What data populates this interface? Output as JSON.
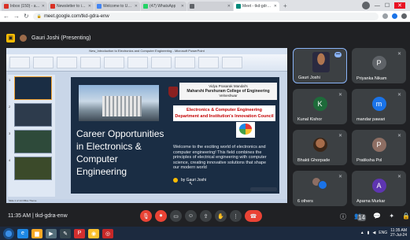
{
  "browser": {
    "tabs": [
      {
        "label": "Inbox (150) - aparna.murkar@...",
        "color": "#d93025",
        "active": false
      },
      {
        "label": "Newsletter to invite as a Resour...",
        "color": "#d93025",
        "active": false
      },
      {
        "label": "Welcome to University of Mur...",
        "color": "#4285f4",
        "active": false
      },
      {
        "label": "(47) WhatsApp",
        "color": "#25d366",
        "active": false
      },
      {
        "label": "",
        "color": "#5f6368",
        "active": false
      },
      {
        "label": "Meet - tkd-gdra-enw",
        "color": "#00897b",
        "active": true
      }
    ],
    "new_tab": "+",
    "url": "meet.google.com/tkd-gdra-enw",
    "controls": {
      "minimize": "—",
      "maximize": "☐",
      "close": "✕"
    }
  },
  "meet": {
    "presenter_label": "Gauri Joshi (Presenting)",
    "time": "11:35 AM",
    "meeting_code": "tkd-gdra-enw",
    "participants_count": "14",
    "participants": [
      {
        "name": "Gauri Joshi",
        "type": "photo",
        "speaking": true
      },
      {
        "name": "Priyanka Nikam",
        "type": "letter",
        "letter": "P",
        "color": "#5f6368"
      },
      {
        "name": "Kunal Kishor",
        "type": "letter",
        "letter": "K",
        "color": "#1e6b3a"
      },
      {
        "name": "mandar pawari",
        "type": "letter",
        "letter": "m",
        "color": "#1a73e8"
      },
      {
        "name": "Bhakti Ghorpade",
        "type": "photo"
      },
      {
        "name": "Pratiksha Pol",
        "type": "letter",
        "letter": "P",
        "color": "#8d6e63"
      },
      {
        "name": "6 others",
        "type": "others"
      },
      {
        "name": "Aparna Murkar",
        "type": "letter",
        "letter": "A",
        "color": "#5e35b1"
      }
    ]
  },
  "ppt": {
    "window_title": "New_Introduction to Electronics and Computer Engineering - Microsoft PowerPoint",
    "slide": {
      "title": "Career Opportunities in Electronics & Computer Engineering",
      "college_lines": [
        "Vidya Prasarak Mandal's",
        "Maharshi Parshuram College of Engineering",
        "Velneshwar"
      ],
      "dept_lines": [
        "Electronics & Computer Engineering",
        "Department and Institution's Innovation Council"
      ],
      "welcome": "Welcome to the exciting world of electronics and computer engineering! This field combines the principles of electrical engineering with computer science, creating innovative solutions that shape our modern world",
      "author": "by Gauri Joshi"
    },
    "status": "Slide 1 of 14   Office Theme"
  },
  "taskbar": {
    "time": "11:35 AM",
    "date": "27-Jul-24",
    "lang": "ENG"
  }
}
